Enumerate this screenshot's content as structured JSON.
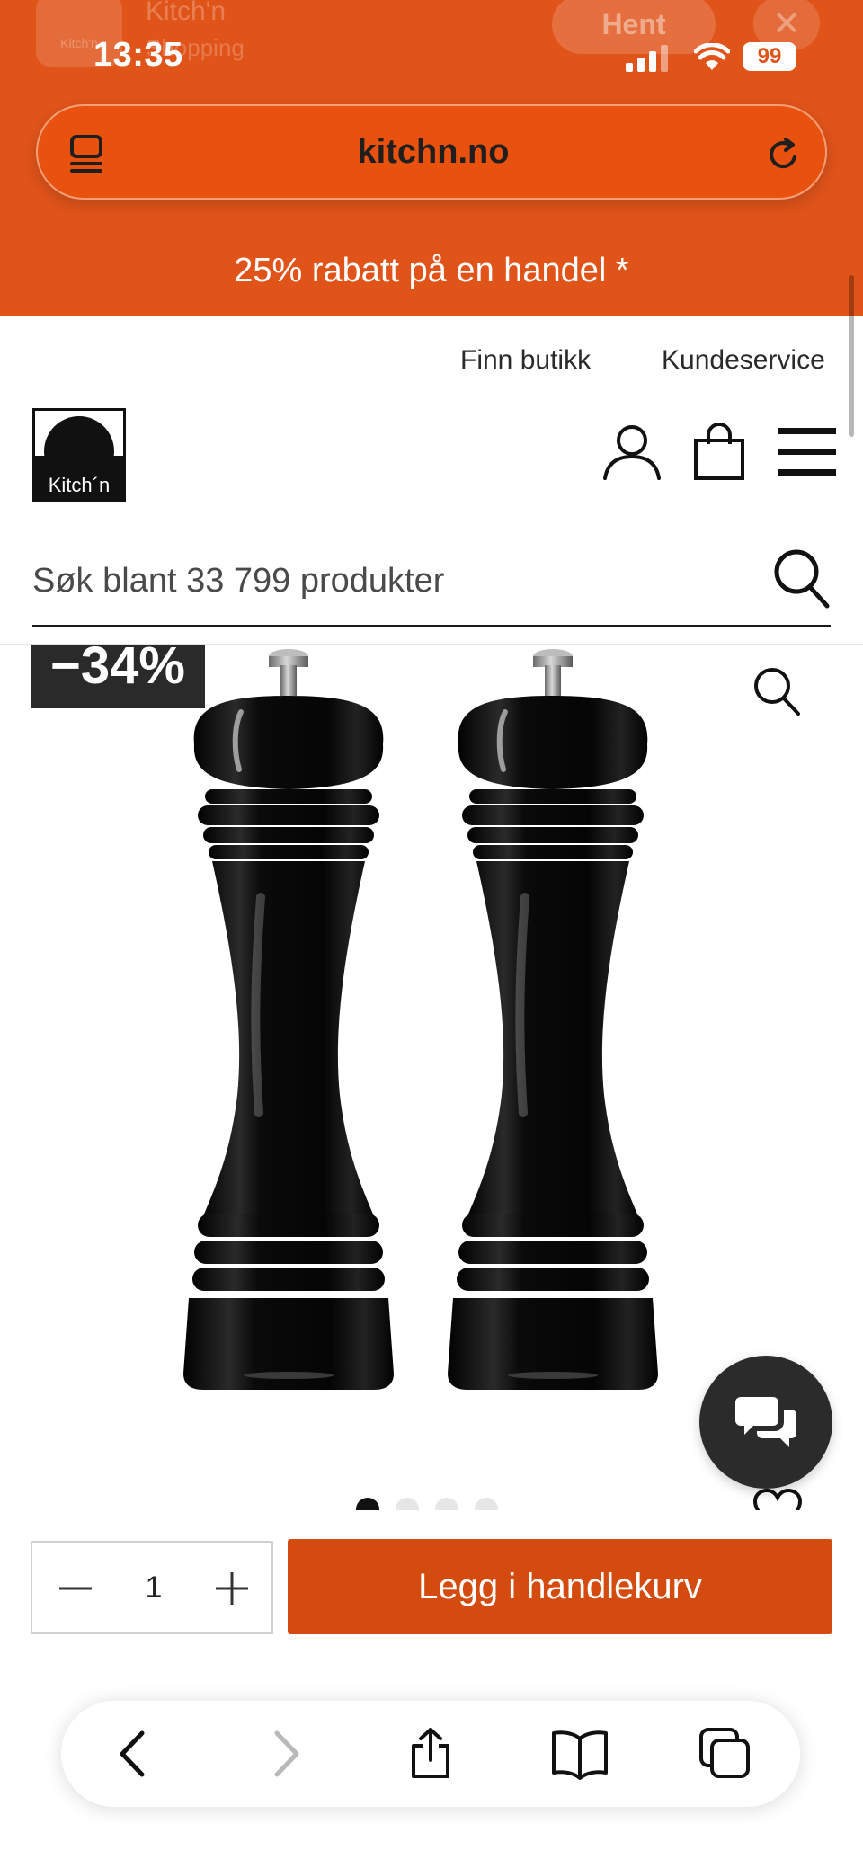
{
  "app_banner": {
    "app_name": "Kitch'n",
    "subtitle": "Shopping",
    "icon_label": "Kitch'n",
    "get_button": "Hent",
    "close_icon": "close-icon"
  },
  "status_bar": {
    "time": "13:35",
    "battery": "99",
    "icons": [
      "cellular-signal-icon",
      "wifi-icon",
      "battery-icon"
    ]
  },
  "browser": {
    "url": "kitchn.no",
    "left_icon": "tab-overview-icon",
    "right_icon": "reload-icon"
  },
  "promo_banner": {
    "text": "25% rabatt på en handel *"
  },
  "header": {
    "links": [
      "Finn butikk",
      "Kundeservice"
    ],
    "logo_text": "Kitch´n",
    "icons": [
      "account-icon",
      "shopping-bag-icon",
      "menu-icon"
    ]
  },
  "search": {
    "placeholder": "Søk blant 33 799 produkter",
    "icon": "search-icon"
  },
  "product": {
    "discount_badge": "−34%",
    "image_count": 4,
    "active_image": 1,
    "quantity": "1",
    "add_to_cart": "Legg i handlekurv"
  },
  "bottom_bar": {
    "icons": [
      "back-icon",
      "forward-icon",
      "share-icon",
      "bookmarks-icon",
      "tabs-icon"
    ]
  },
  "colors": {
    "brand_orange": "#e0541a",
    "cta_orange": "#d44b0f",
    "dark": "#1a1a1a"
  }
}
